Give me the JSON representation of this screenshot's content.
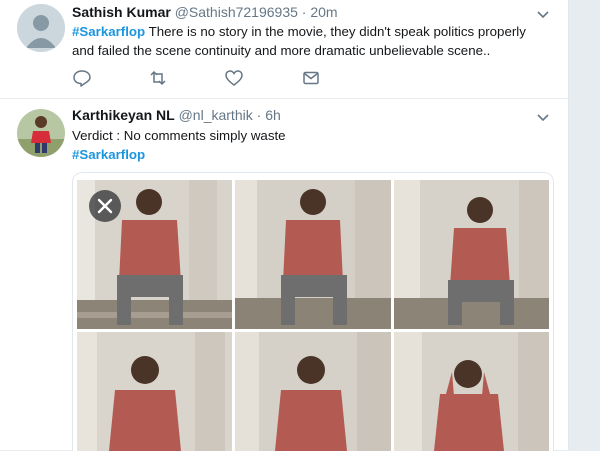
{
  "tweets": [
    {
      "name": "Sathish Kumar",
      "handle": "@Sathish72196935",
      "separator": "·",
      "time": "20m",
      "hashtag": "#Sarkarflop",
      "text": " There is no story in the movie, they didn't speak politics properly and failed the scene continuity and more dramatic unbelievable scene..",
      "actions": [
        "reply-icon",
        "retweet-icon",
        "like-icon",
        "message-icon"
      ]
    },
    {
      "name": "Karthikeyan NL",
      "handle": "@nl_karthik",
      "separator": "·",
      "time": "6h",
      "line1": "Verdict : No comments simply waste",
      "hashtag": "#Sarkarflop"
    }
  ],
  "media": {
    "close_icon": "close-icon",
    "panels": 6,
    "colors": {
      "shirt": "#b35a52",
      "pants": "#6e6e6e",
      "ground": "#8d8478",
      "crowd": "#d8d4cc"
    }
  },
  "colors": {
    "accent": "#1b95e0",
    "muted": "#657786",
    "text": "#14171a",
    "border": "#e6ecf0"
  }
}
